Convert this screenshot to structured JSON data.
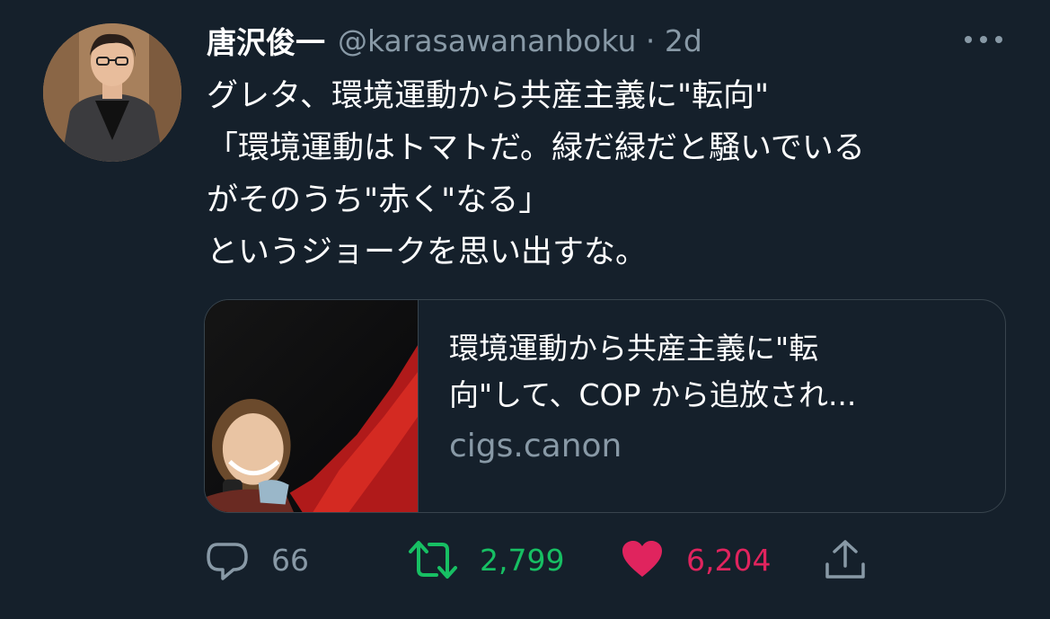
{
  "author": {
    "display_name": "唐沢俊一",
    "handle_time": "@karasawananboku · 2d"
  },
  "tweet": {
    "text": "グレタ、環境運動から共産主義に\"転向\"\n「環境運動はトマトだ。緑だ緑だと騒いでいる\nがそのうち\"赤く\"なる」\nというジョークを思い出すな。"
  },
  "link_card": {
    "title": "環境運動から共産主義に\"転\n向\"して、COP から追放され...",
    "domain": "cigs.canon"
  },
  "actions": {
    "replies": "66",
    "retweets": "2,799",
    "likes": "6,204"
  },
  "icons": {
    "reply": "speech-bubble-icon",
    "retweet": "retweet-arrows-icon",
    "like": "heart-icon",
    "share": "share-upload-icon",
    "more": "more-dots-icon"
  },
  "colors": {
    "background": "#15202b",
    "secondary_text": "#8899a6",
    "retweet_active": "#17bf63",
    "like_active": "#e0245e",
    "border": "#38444d"
  }
}
